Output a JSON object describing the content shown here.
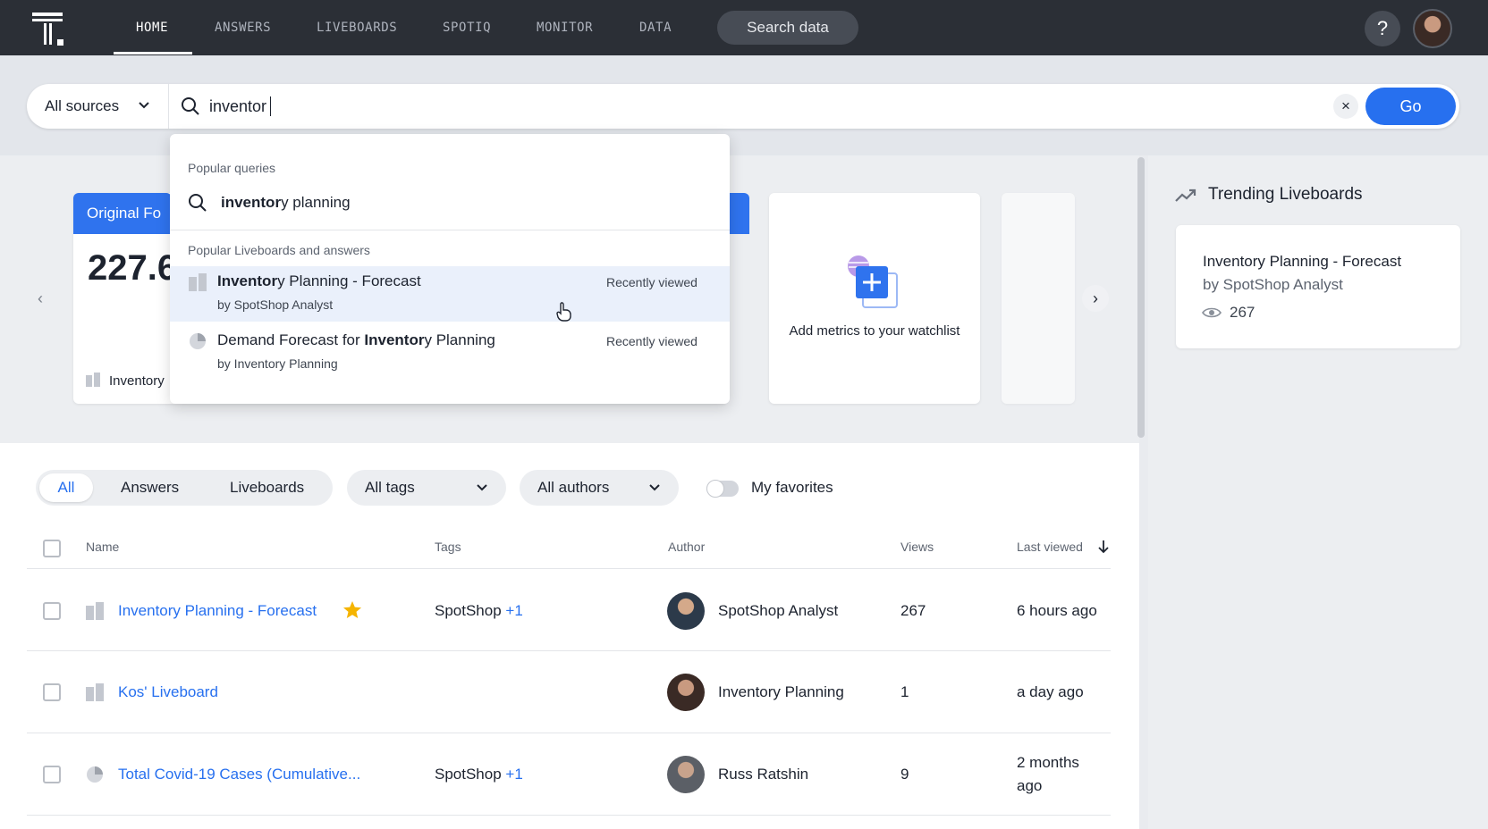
{
  "nav": {
    "items": [
      "HOME",
      "ANSWERS",
      "LIVEBOARDS",
      "SPOTIQ",
      "MONITOR",
      "DATA"
    ],
    "active": "HOME",
    "search_pill": "Search data",
    "help": "?"
  },
  "search": {
    "source": "All sources",
    "query": "inventor",
    "clear": "×",
    "go": "Go"
  },
  "dropdown": {
    "popular_queries_label": "Popular queries",
    "query_match": "inventor",
    "query_rest": "y planning",
    "popular_items_label": "Popular Liveboards and answers",
    "items": [
      {
        "title_match": "Inventor",
        "title_rest": "y Planning - Forecast",
        "by": "by SpotShop Analyst",
        "meta": "Recently viewed"
      },
      {
        "title_pre": "Demand Forecast for ",
        "title_match": "Inventor",
        "title_rest": "y Planning",
        "by": "by Inventory Planning",
        "meta": "Recently viewed"
      }
    ]
  },
  "watchlist": {
    "card1_head": "Original Fo",
    "card1_value": "227.6",
    "card1_foot": "Inventory",
    "add_label": "Add metrics to your watchlist"
  },
  "filters": {
    "segments": [
      "All",
      "Answers",
      "Liveboards"
    ],
    "active_segment": "All",
    "tags": "All tags",
    "authors": "All authors",
    "favorites": "My favorites"
  },
  "table": {
    "headers": {
      "name": "Name",
      "tags": "Tags",
      "author": "Author",
      "views": "Views",
      "last_viewed": "Last viewed"
    },
    "rows": [
      {
        "name": "Inventory Planning - Forecast",
        "tag": "SpotShop",
        "tag_more": "+1",
        "author": "SpotShop Analyst",
        "views": "267",
        "last_viewed": "6 hours ago",
        "favorite": true
      },
      {
        "name": "Kos' Liveboard",
        "tag": "",
        "tag_more": "",
        "author": "Inventory Planning",
        "views": "1",
        "last_viewed": "a day ago",
        "favorite": false
      },
      {
        "name": "Total Covid-19 Cases (Cumulative...",
        "tag": "SpotShop",
        "tag_more": "+1",
        "author": "Russ Ratshin",
        "views": "9",
        "last_viewed_1": "2 months",
        "last_viewed_2": "ago",
        "favorite": false
      }
    ]
  },
  "trending": {
    "title": "Trending Liveboards",
    "item_name": "Inventory Planning - Forecast",
    "item_by": "by SpotShop Analyst",
    "item_views": "267"
  },
  "colors": {
    "accent": "#2770ef",
    "nav_bg": "#2b2f36",
    "star": "#f5b400"
  }
}
